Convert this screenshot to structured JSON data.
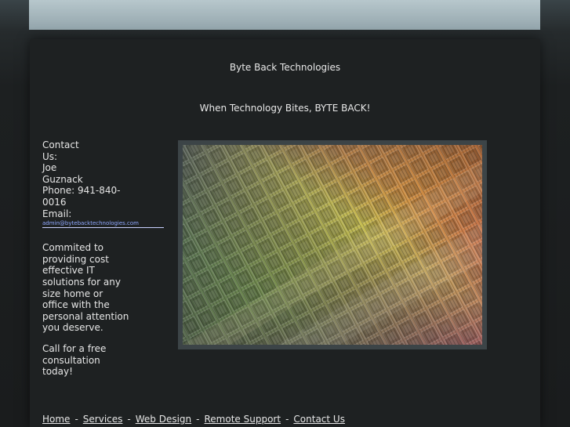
{
  "site": {
    "title": "Byte Back Technologies",
    "tagline": "When Technology Bites, BYTE BACK!"
  },
  "sidebar": {
    "contact_heading": "Contact Us:",
    "name": "Joe Guznack",
    "phone": "Phone: 941-840-0016",
    "email_label": "Email:",
    "email_link": "admin@bytebacktechnologies.com",
    "mission": "Commited to providing cost effective IT solutions for any size home or office with the personal attention you deserve.",
    "cta": "Call for a free consultation today!"
  },
  "hero_image": {
    "icon": "circuit-wafer-photo"
  },
  "footer": {
    "separator": "-",
    "links": [
      "Home",
      "Services",
      "Web Design",
      "Remote Support",
      "Contact Us"
    ]
  }
}
